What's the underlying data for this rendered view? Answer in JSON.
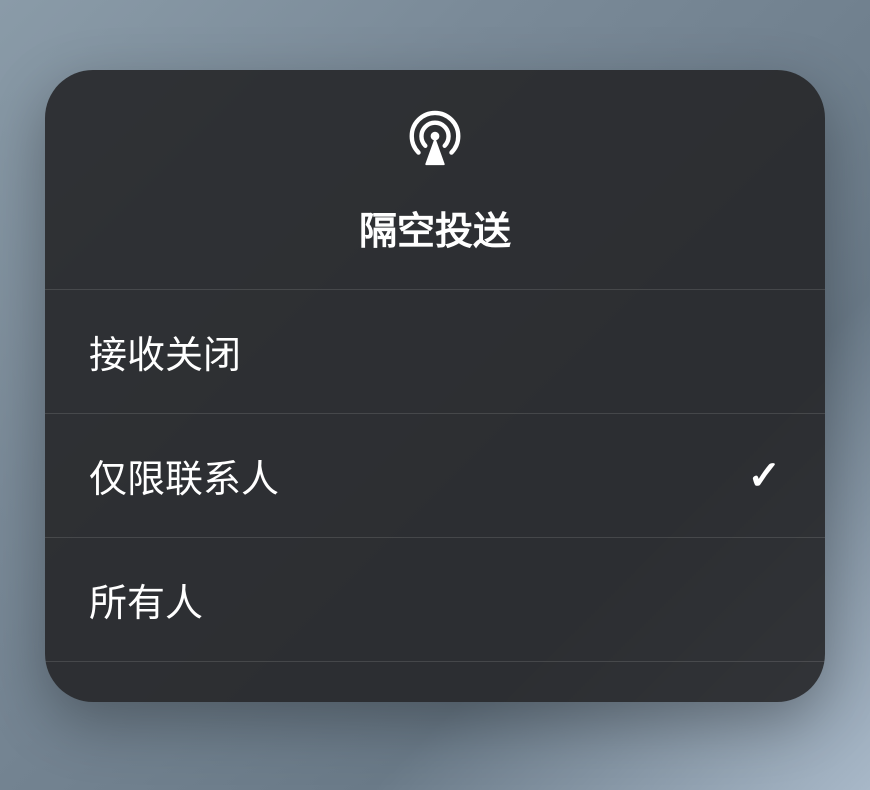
{
  "header": {
    "title": "隔空投送",
    "icon": "airdrop-icon"
  },
  "options": [
    {
      "label": "接收关闭",
      "selected": false
    },
    {
      "label": "仅限联系人",
      "selected": true
    },
    {
      "label": "所有人",
      "selected": false
    }
  ]
}
